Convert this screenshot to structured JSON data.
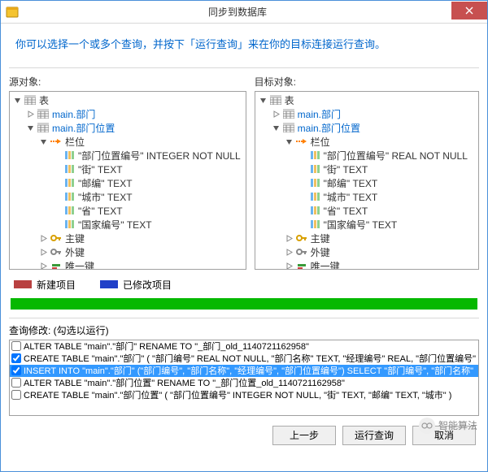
{
  "window": {
    "title": "同步到数据库"
  },
  "instruction": "你可以选择一个或多个查询，并按下「运行查询」来在你的目标连接运行查询。",
  "source": {
    "label": "源对象:",
    "root": "表",
    "items": [
      "main.部门",
      "main.部门位置"
    ],
    "columnsHeader": "栏位",
    "columns": [
      "\"部门位置编号\" INTEGER NOT NULL",
      "\"街\" TEXT",
      "\"邮编\" TEXT",
      "\"城市\" TEXT",
      "\"省\" TEXT",
      "\"国家编号\" TEXT"
    ],
    "keys": [
      "主键",
      "外键",
      "唯一键"
    ]
  },
  "target": {
    "label": "目标对象:",
    "root": "表",
    "items": [
      "main.部门",
      "main.部门位置"
    ],
    "columnsHeader": "栏位",
    "columns": [
      "\"部门位置编号\" REAL NOT NULL",
      "\"街\" TEXT",
      "\"邮编\" TEXT",
      "\"城市\" TEXT",
      "\"省\" TEXT",
      "\"国家编号\" TEXT"
    ],
    "keys": [
      "主键",
      "外键",
      "唯一键"
    ]
  },
  "legend": {
    "new": "新建项目",
    "modified": "已修改项目"
  },
  "querySection": {
    "label": "查询修改: (勾选以运行)",
    "queries": [
      {
        "checked": false,
        "selected": false,
        "text": "ALTER TABLE \"main\".\"部门\" RENAME TO \"_部门_old_1140721162958\""
      },
      {
        "checked": true,
        "selected": false,
        "text": "CREATE TABLE \"main\".\"部门\" ( \"部门编号\" REAL NOT NULL, \"部门名称\" TEXT, \"经理编号\" REAL, \"部门位置编号\" )"
      },
      {
        "checked": true,
        "selected": true,
        "text": "INSERT INTO \"main\".\"部门\" (\"部门编号\", \"部门名称\", \"经理编号\", \"部门位置编号\") SELECT \"部门编号\", \"部门名称\""
      },
      {
        "checked": false,
        "selected": false,
        "text": "ALTER TABLE \"main\".\"部门位置\" RENAME TO \"_部门位置_old_1140721162958\""
      },
      {
        "checked": false,
        "selected": false,
        "text": "CREATE TABLE \"main\".\"部门位置\" ( \"部门位置编号\" INTEGER NOT NULL, \"街\" TEXT, \"邮编\" TEXT, \"城市\" )"
      }
    ]
  },
  "buttons": {
    "prev": "上一步",
    "run": "运行查询",
    "cancel": "取消"
  },
  "watermark": "智能算法"
}
